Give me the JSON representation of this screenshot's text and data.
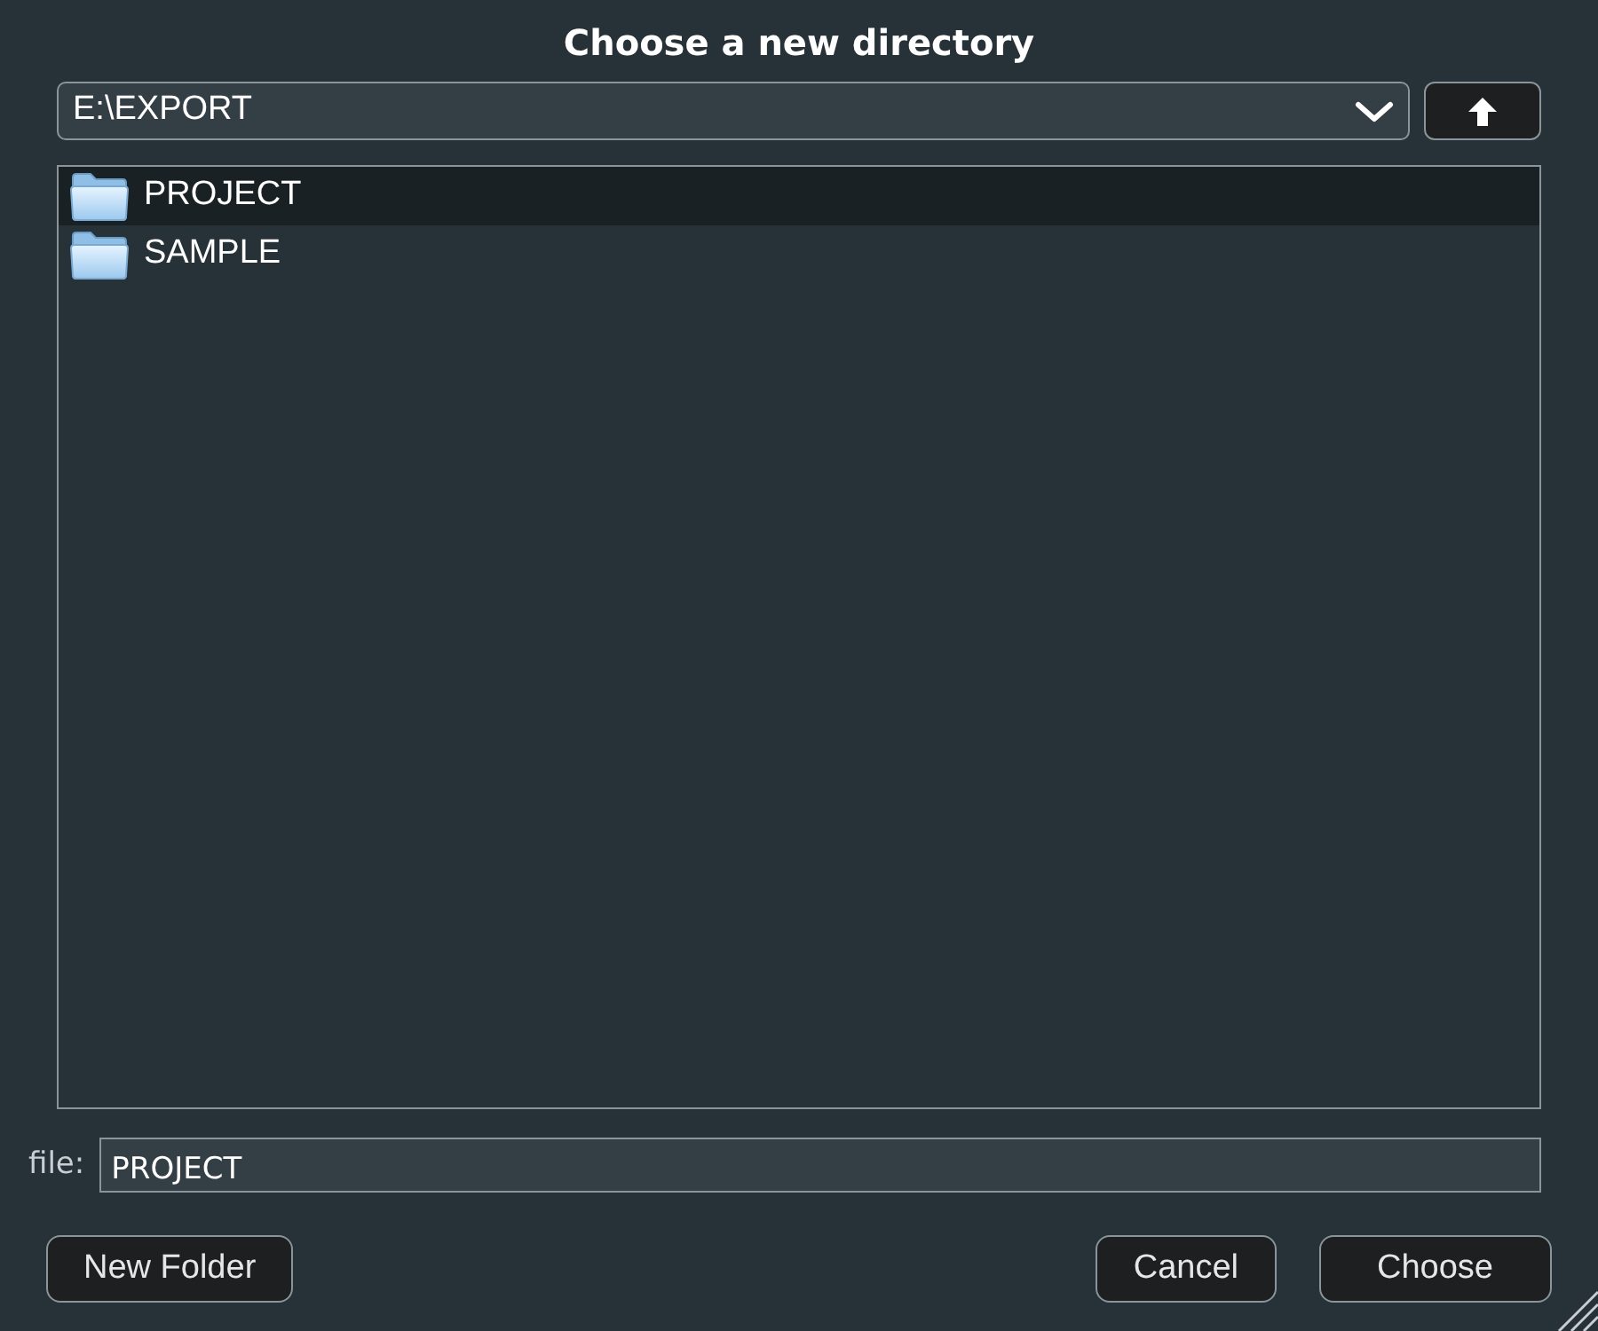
{
  "window": {
    "title": "Choose a new directory"
  },
  "path": {
    "value": "E:\\EXPORT"
  },
  "folders": [
    {
      "name": "PROJECT",
      "selected": true
    },
    {
      "name": "SAMPLE",
      "selected": false
    }
  ],
  "file": {
    "label": "file:",
    "value": "PROJECT"
  },
  "buttons": [
    {
      "label": "New Folder",
      "kind": "left"
    },
    {
      "label": "Cancel",
      "kind": "right"
    },
    {
      "label": "Choose",
      "kind": "right"
    }
  ]
}
